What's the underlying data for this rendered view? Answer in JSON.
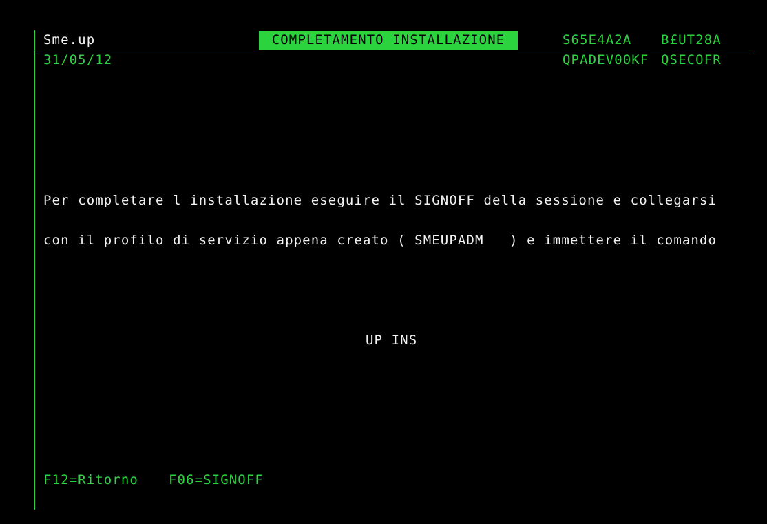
{
  "header": {
    "app_name": "Sme.up",
    "date": "31/05/12",
    "title": "COMPLETAMENTO INSTALLAZIONE",
    "system_name": "S65E4A2A",
    "program_name": "B£UT28A",
    "device_name": "QPADEV00KF",
    "user_name": "QSECOFR"
  },
  "body": {
    "line1": "Per completare l installazione eseguire il SIGNOFF della sessione e collegarsi",
    "line2": "con il profilo di servizio appena creato ( SMEUPADM   ) e immettere il comando",
    "command": "UP INS"
  },
  "footer": {
    "f12": "F12=Ritorno",
    "f06": "F06=SIGNOFF"
  },
  "colors": {
    "foreground": "#2bd43e",
    "background": "#000000",
    "highlight_text": "#f2f2f2"
  }
}
